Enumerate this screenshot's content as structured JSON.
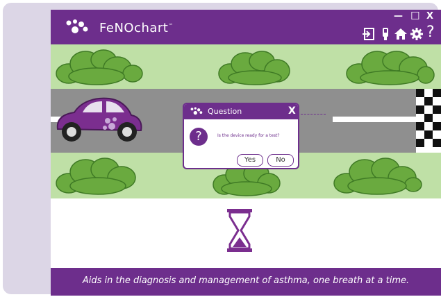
{
  "app": {
    "brand": "FeNOchart",
    "trademark": "™",
    "tagline": "Aids in the diagnosis and management of asthma, one breath at a time."
  },
  "window_controls": {
    "minimize": "—",
    "maximize": "☐",
    "close": "X"
  },
  "toolbar": {
    "icons": [
      "login-icon",
      "device-icon",
      "home-icon",
      "gear-icon",
      "help-icon"
    ],
    "help_label": "?"
  },
  "dialog": {
    "title": "Question",
    "close_label": "X",
    "icon_label": "?",
    "message": "Is the device ready for a test?",
    "yes_label": "Yes",
    "no_label": "No"
  },
  "colors": {
    "brand_purple": "#6d2e8c",
    "grass": "#bfe0a6",
    "road": "#8f8f8f",
    "bush": "#6aaa3f"
  }
}
